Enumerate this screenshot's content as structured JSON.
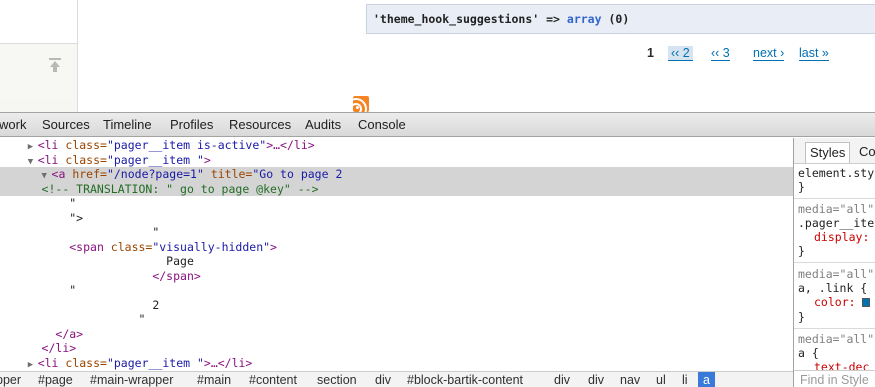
{
  "page": {
    "devel_row": {
      "key": "'theme_hook_suggestions'",
      "arrow": "=>",
      "type": "array",
      "count": "(0)"
    },
    "pager": {
      "current": "1",
      "page2": "‹‹ 2",
      "page3": "‹‹ 3",
      "next": "next ›",
      "last": "last »"
    }
  },
  "devtools": {
    "tabs": [
      "work",
      "Sources",
      "Timeline",
      "Profiles",
      "Resources",
      "Audits",
      "Console"
    ],
    "tree": {
      "l1": {
        "open": "<li",
        "attr": " class=",
        "val": "\"pager__item is-active\"",
        "rest": ">…</li>"
      },
      "l2": {
        "open": "<li",
        "attr": " class=",
        "val": "\"pager__item \"",
        "rest": ">"
      },
      "l3": {
        "open": "<a",
        "attr1": " href=",
        "val1": "\"/node?page=1\"",
        "attr2": " title=",
        "val2": "\"Go to page 2"
      },
      "l4": {
        "comment": "<!-- TRANSLATION: \" go to page @key\" -->"
      },
      "l5": "\"",
      "l6": "\">",
      "l7": "\"",
      "l8": {
        "open": "<span",
        "attr": " class=",
        "val": "\"visually-hidden\"",
        "rest": ">"
      },
      "l9": "Page",
      "l10": "</span>",
      "l11": "\"",
      "l12": "2",
      "l13": "\"",
      "l14": "</a>",
      "l15": "</li>",
      "l16": {
        "open": "<li",
        "attr": " class=",
        "val": "\"pager__item \"",
        "rest": ">…</li>"
      }
    },
    "styles": {
      "tab_active": "Styles",
      "tab_second": "Co",
      "element_style": "element.sty",
      "brace": "}",
      "media1": "media=\"all\"",
      "selector1": ".pager__ite",
      "prop1": "display:",
      "media2": "media=\"all\"",
      "selector2": "a, .link {",
      "prop2": "color:",
      "media3": "media=\"all\"",
      "selector3": "a {",
      "prop3": "text-dec",
      "filter_placeholder": "Find in Style",
      "link_color": "#0071b3"
    },
    "breadcrumbs": [
      "pper",
      "#page",
      "#main-wrapper",
      "#main",
      "#content",
      "section",
      "div",
      "#block-bartik-content",
      "div",
      "div",
      "nav",
      "ul",
      "li",
      "a"
    ]
  }
}
